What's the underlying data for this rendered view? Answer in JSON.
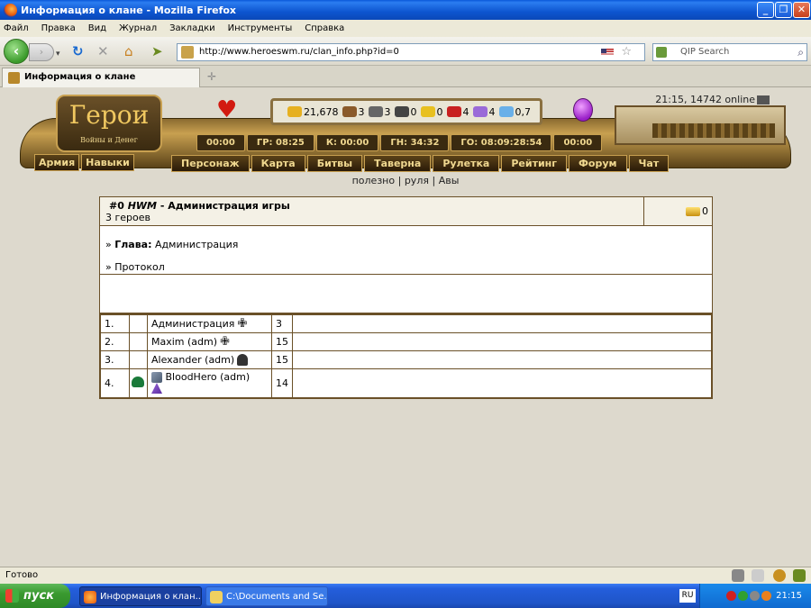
{
  "window": {
    "title": "Информация о клане - Mozilla Firefox"
  },
  "menu": [
    "Файл",
    "Правка",
    "Вид",
    "Журнал",
    "Закладки",
    "Инструменты",
    "Справка"
  ],
  "nav": {
    "url": "http://www.heroeswm.ru/clan_info.php?id=0",
    "search_placeholder": "QIP Search"
  },
  "tab": {
    "label": "Информация о клане"
  },
  "game": {
    "logo_title": "Герои",
    "logo_subtitle": "Войны и Денег",
    "online": "21:15, 14742 online",
    "resources": [
      {
        "icon": "gold-icon",
        "value": "21,678",
        "color": "#e6b020"
      },
      {
        "icon": "wood-icon",
        "value": "3",
        "color": "#8a5a2a"
      },
      {
        "icon": "ore-icon",
        "value": "3",
        "color": "#666666"
      },
      {
        "icon": "mercury-icon",
        "value": "0",
        "color": "#444444"
      },
      {
        "icon": "sulfur-icon",
        "value": "0",
        "color": "#e8c020"
      },
      {
        "icon": "crystal-icon",
        "value": "4",
        "color": "#c82020"
      },
      {
        "icon": "gems-icon",
        "value": "4",
        "color": "#9a6ad8"
      },
      {
        "icon": "diamond-icon",
        "value": "0,7",
        "color": "#6ab0e8"
      }
    ],
    "timers": [
      "00:00",
      "ГР: 08:25",
      "К: 00:00",
      "ГН: 34:32",
      "ГО: 08:09:28:54",
      "00:00"
    ],
    "left_nav": [
      "Армия",
      "Навыки"
    ],
    "main_nav": [
      "Персонаж",
      "Карта",
      "Битвы",
      "Таверна",
      "Рулетка",
      "Рейтинг",
      "Форум",
      "Чат"
    ],
    "links": [
      "полезно",
      "|",
      "руля",
      "|",
      "Авы"
    ]
  },
  "clan": {
    "id": "#0",
    "tag": "HWM",
    "separator": " - ",
    "name": "Администрация игры",
    "count": "3 героев",
    "gold": "0",
    "head_prefix": "»",
    "head_label": "Глава:",
    "head_value": "Администрация",
    "protocol_prefix": "»",
    "protocol": "Протокол",
    "members": [
      {
        "num": "1.",
        "name": "Администрация",
        "level": "3",
        "emblem": "cross-icon"
      },
      {
        "num": "2.",
        "name": "Maxim (adm)",
        "level": "15",
        "emblem": "cross-icon"
      },
      {
        "num": "3.",
        "name": "Alexander (adm)",
        "level": "15",
        "emblem": "helmet-icon"
      },
      {
        "num": "4.",
        "name": "BloodHero (adm)",
        "level": "14",
        "emblem": "wand-icon"
      }
    ]
  },
  "status": {
    "text": "Готово"
  },
  "taskbar": {
    "start": "пуск",
    "tasks": [
      "Информация о клан...",
      "C:\\Documents and Se..."
    ],
    "lang": "RU",
    "clock": "21:15"
  }
}
